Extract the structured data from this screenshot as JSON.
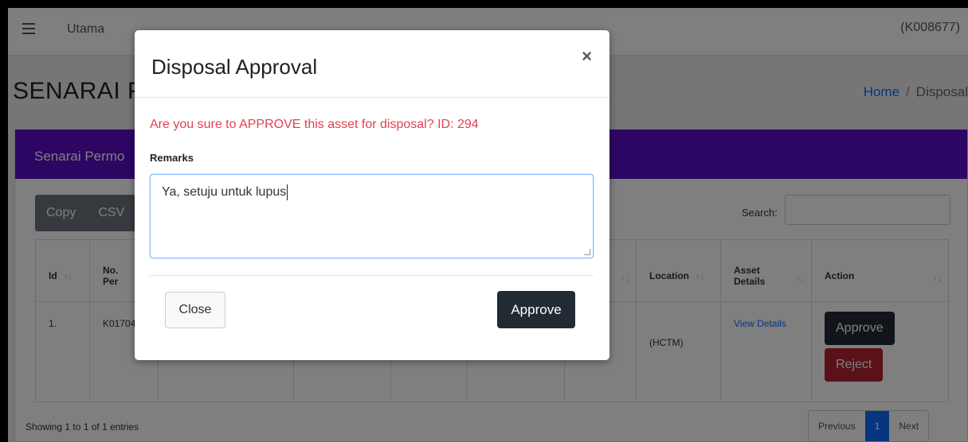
{
  "topbar": {
    "title": "Utama",
    "user": "(K008677)"
  },
  "page": {
    "heading": "SENARAI P"
  },
  "breadcrumb": {
    "home": "Home",
    "separator": "/",
    "current": "Disposal"
  },
  "card": {
    "header": "Senarai Permo"
  },
  "toolbar": {
    "copy": "Copy",
    "csv": "CSV"
  },
  "search": {
    "label": "Search:",
    "value": ""
  },
  "table": {
    "headers": {
      "id": "Id",
      "no_per_1": "No.",
      "no_per_2": "Per",
      "location": "Location",
      "asset_1": "Asset",
      "asset_2": "Details",
      "action": "Action"
    },
    "rows": [
      {
        "id": "1.",
        "no_per": "K01704",
        "location": "(HCTM)",
        "asset_link": "View Details",
        "approve": "Approve",
        "reject": "Reject"
      }
    ]
  },
  "footer": {
    "info": "Showing 1 to 1 of 1 entries"
  },
  "pager": {
    "previous": "Previous",
    "current": "1",
    "next": "Next"
  },
  "modal": {
    "title": "Disposal Approval",
    "close_icon": "×",
    "message": "Are you sure to APPROVE this asset for disposal? ID: 294",
    "remarks_label": "Remarks",
    "remarks_value": "Ya, setuju untuk lupus",
    "close_button": "Close",
    "approve_button": "Approve"
  },
  "colors": {
    "accent": "#5b0cc8",
    "danger": "#e0424f",
    "primary": "#0d6efd",
    "dark": "#222b33"
  }
}
